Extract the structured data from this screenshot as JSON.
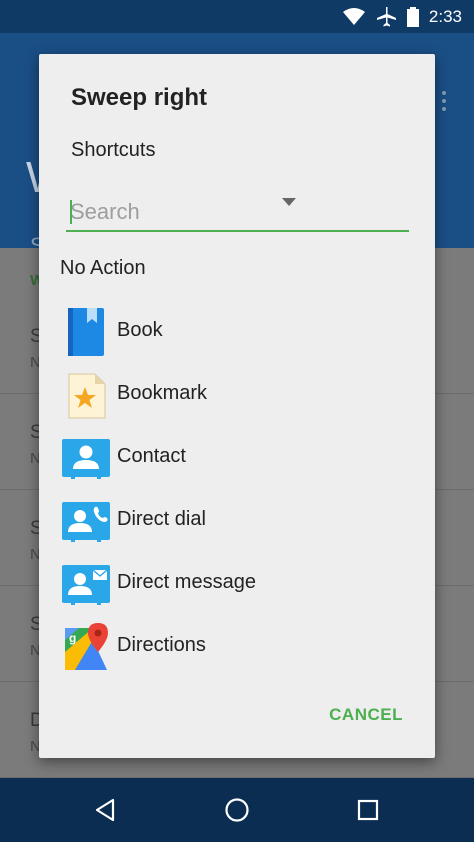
{
  "status_bar": {
    "time": "2:33",
    "icons": [
      "wifi-icon",
      "airplane-icon",
      "battery-icon"
    ]
  },
  "background_app": {
    "title_fragment": "W",
    "subtitle_fragment": "S",
    "section_fragment": "W",
    "rows": [
      {
        "line1": "S",
        "line2": "N"
      },
      {
        "line1": "S",
        "line2": "N"
      },
      {
        "line1": "S",
        "line2": "N"
      },
      {
        "line1": "S",
        "line2": "N"
      },
      {
        "line1": "D",
        "line2": "N"
      }
    ]
  },
  "dialog": {
    "title": "Sweep right",
    "spinner": {
      "selected": "Shortcuts"
    },
    "search": {
      "placeholder": "Search",
      "value": ""
    },
    "no_action_label": "No Action",
    "items": [
      {
        "label": "Book",
        "icon": "book-icon"
      },
      {
        "label": "Bookmark",
        "icon": "bookmark-icon"
      },
      {
        "label": "Contact",
        "icon": "contact-icon"
      },
      {
        "label": "Direct dial",
        "icon": "direct-dial-icon"
      },
      {
        "label": "Direct message",
        "icon": "direct-message-icon"
      },
      {
        "label": "Directions",
        "icon": "directions-icon"
      }
    ],
    "cancel_label": "CANCEL"
  },
  "nav_bar": {
    "buttons": [
      "back-icon",
      "home-icon",
      "recents-icon"
    ]
  },
  "colors": {
    "accent": "#4caf50",
    "status_bar": "#0f3a66",
    "app_bar": "#1a4f86",
    "nav_bar": "#0b2d52",
    "dialog_bg": "#eeeeee"
  }
}
